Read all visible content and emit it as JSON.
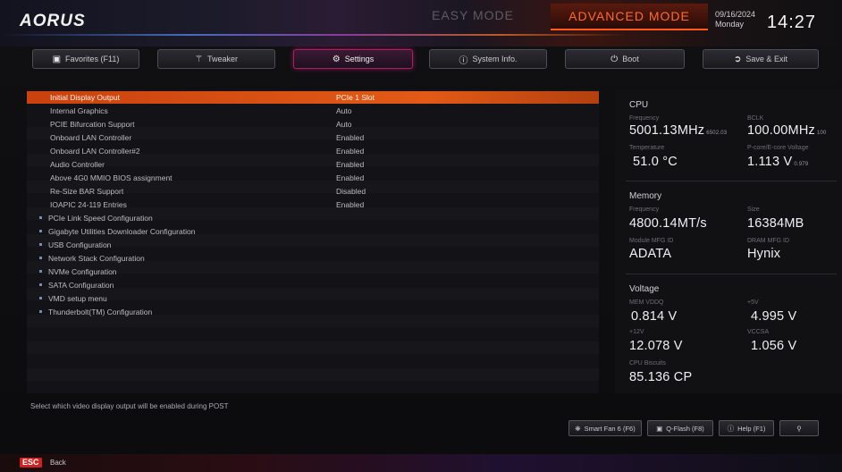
{
  "header": {
    "logo": "AORUS",
    "easy_mode": "EASY MODE",
    "advanced_mode": "ADVANCED MODE",
    "date": "09/16/2024",
    "day": "Monday",
    "time": "14:27"
  },
  "tabs": [
    {
      "label": "Favorites (F11)",
      "icon": "star-icon"
    },
    {
      "label": "Tweaker",
      "icon": "tweaker-icon"
    },
    {
      "label": "Settings",
      "icon": "gear-icon"
    },
    {
      "label": "System Info.",
      "icon": "info-icon"
    },
    {
      "label": "Boot",
      "icon": "power-icon"
    },
    {
      "label": "Save & Exit",
      "icon": "exit-icon"
    }
  ],
  "settings": [
    {
      "name": "Initial Display Output",
      "value": "PCIe 1 Slot"
    },
    {
      "name": "Internal Graphics",
      "value": "Auto"
    },
    {
      "name": "PCIE Bifurcation Support",
      "value": "Auto"
    },
    {
      "name": "Onboard LAN Controller",
      "value": "Enabled"
    },
    {
      "name": "Onboard LAN Controller#2",
      "value": "Enabled"
    },
    {
      "name": "Audio Controller",
      "value": "Enabled"
    },
    {
      "name": "Above 4G0 MMIO BIOS assignment",
      "value": "Enabled"
    },
    {
      "name": "Re-Size BAR Support",
      "value": "Disabled"
    },
    {
      "name": "IOAPIC 24-119 Entries",
      "value": "Enabled"
    }
  ],
  "submenus": [
    "PCIe Link Speed Configuration",
    "Gigabyte Utilities Downloader Configuration",
    "USB Configuration",
    "Network Stack Configuration",
    "NVMe Configuration",
    "SATA Configuration",
    "VMD setup menu",
    "Thunderbolt(TM) Configuration"
  ],
  "hint": "Select which video display output will be enabled during POST",
  "cpu": {
    "title": "CPU",
    "freq_label": "Frequency",
    "freq": "5001.13MHz",
    "freq_sub": "6502.03",
    "bclk_label": "BCLK",
    "bclk": "100.00MHz",
    "bclk_sub": "100",
    "temp_label": "Temperature",
    "temp": "51.0 °C",
    "vcore_label": "P-core/E-core Voltage",
    "vcore": "1.113 V",
    "vcore_sub": "0.979"
  },
  "memory": {
    "title": "Memory",
    "freq_label": "Frequency",
    "freq": "4800.14MT/s",
    "size_label": "Size",
    "size": "16384MB",
    "module_label": "Module MFG ID",
    "module": "ADATA",
    "dram_label": "DRAM MFG ID",
    "dram": "Hynix"
  },
  "voltage": {
    "title": "Voltage",
    "vddq_label": "MEM VDDQ",
    "vddq": "0.814 V",
    "p5v_label": "+5V",
    "p5v": "4.995 V",
    "p12v_label": "+12V",
    "p12v": "12.078 V",
    "vccsa_label": "VCCSA",
    "vccsa": "1.056 V",
    "cpu_biscuits_label": "CPU Biscuits",
    "cpu_biscuits": "85.136 CP"
  },
  "bottom_buttons": [
    {
      "label": "Smart Fan 6 (F6)",
      "icon": "fan-icon"
    },
    {
      "label": "Q-Flash (F8)",
      "icon": "qflash-icon"
    },
    {
      "label": "Help (F1)",
      "icon": "help-icon"
    },
    {
      "label": "",
      "icon": "search-icon"
    }
  ],
  "footer": {
    "esc": "ESC",
    "back": "Back"
  }
}
